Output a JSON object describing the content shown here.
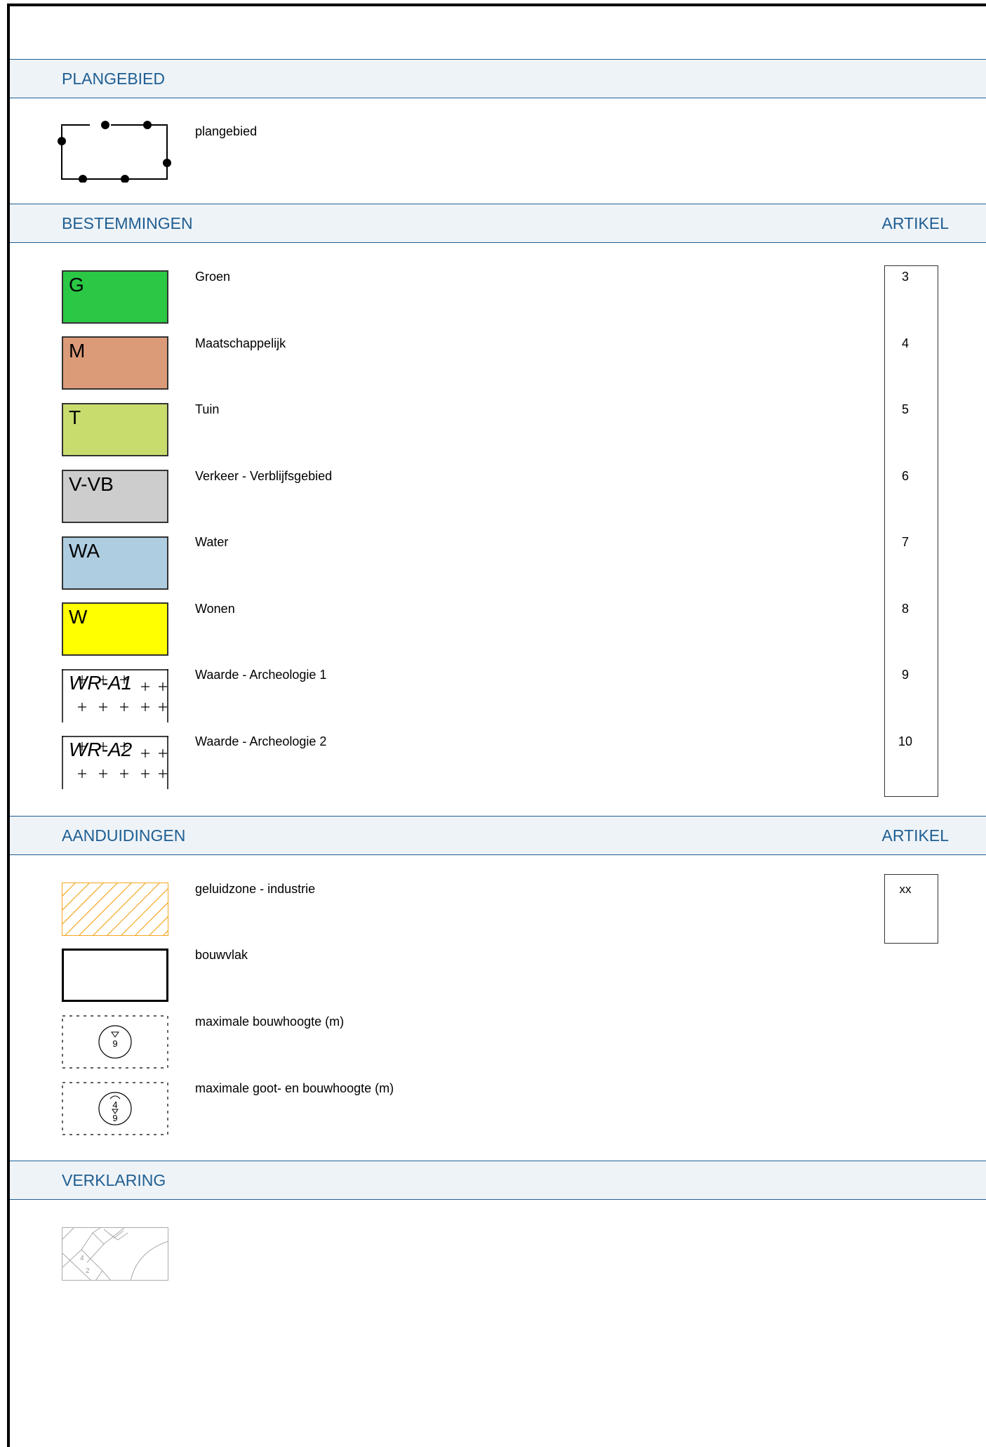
{
  "sections": {
    "plangebied": {
      "title": "PLANGEBIED"
    },
    "bestemmingen": {
      "title": "BESTEMMINGEN",
      "artikel": "ARTIKEL"
    },
    "aanduidingen": {
      "title": "AANDUIDINGEN",
      "artikel": "ARTIKEL"
    },
    "verklaring": {
      "title": "VERKLARING"
    }
  },
  "plangebied": {
    "label": "plangebied"
  },
  "bestemmingen": [
    {
      "code": "G",
      "label": "Groen",
      "artikel": "3",
      "color": "#2ac844"
    },
    {
      "code": "M",
      "label": "Maatschappelijk",
      "artikel": "4",
      "color": "#dc9b78"
    },
    {
      "code": "T",
      "label": "Tuin",
      "artikel": "5",
      "color": "#c8dc6e"
    },
    {
      "code": "V-VB",
      "label": "Verkeer - Verblijfsgebied",
      "artikel": "6",
      "color": "#cdcdcd"
    },
    {
      "code": "WA",
      "label": "Water",
      "artikel": "7",
      "color": "#afcde1"
    },
    {
      "code": "W",
      "label": "Wonen",
      "artikel": "8",
      "color": "#ffff00"
    },
    {
      "code": "WR-A1",
      "label": "Waarde - Archeologie 1",
      "artikel": "9",
      "color": "#ffffff"
    },
    {
      "code": "WR-A2",
      "label": "Waarde - Archeologie 2",
      "artikel": "10",
      "color": "#ffffff"
    }
  ],
  "aanduidingen": [
    {
      "label": "geluidzone - industrie",
      "artikel": "xx",
      "color": "#f5a623",
      "icon": "diagonal-hatch"
    },
    {
      "label": "bouwvlak",
      "icon": "thick-rectangle"
    },
    {
      "label": "maximale bouwhoogte (m)",
      "icon": "height-circle",
      "value": "9"
    },
    {
      "label": "maximale goot- en bouwhoogte (m)",
      "icon": "double-height-circle",
      "value_top": "4",
      "value_bottom": "9"
    }
  ],
  "verklaring": {
    "icon": "cadastral-map",
    "numbers": [
      "4",
      "2"
    ]
  }
}
